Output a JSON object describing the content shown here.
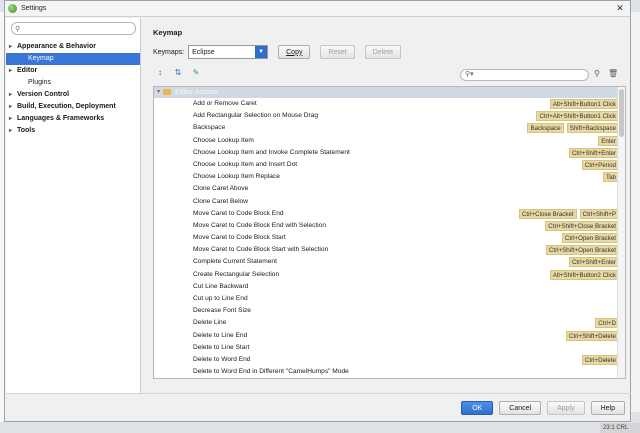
{
  "window": {
    "title": "Settings",
    "close_glyph": "✕"
  },
  "sidebar": {
    "search_placeholder": "",
    "items": [
      {
        "label": "Appearance & Behavior",
        "expander": "▸",
        "bold": true
      },
      {
        "label": "Keymap",
        "selected": true
      },
      {
        "label": "Editor",
        "expander": "▸",
        "bold": true
      },
      {
        "label": "Plugins"
      },
      {
        "label": "Version Control",
        "expander": "▸",
        "bold": true
      },
      {
        "label": "Build, Execution, Deployment",
        "expander": "▸",
        "bold": true
      },
      {
        "label": "Languages & Frameworks",
        "expander": "▸",
        "bold": true
      },
      {
        "label": "Tools",
        "expander": "▸",
        "bold": true
      }
    ]
  },
  "main": {
    "heading": "Keymap",
    "keymaps_label": "Keymaps:",
    "keymap_selected": "Eclipse",
    "copy_label": "Copy",
    "reset_label": "Reset",
    "delete_label": "Delete",
    "filter_placeholder": "",
    "group": {
      "label": "Editor Actions",
      "expander": "▾"
    },
    "actions": [
      {
        "name": "Add or Remove Caret",
        "shortcuts": [
          "Alt+Shift+Button1 Click"
        ]
      },
      {
        "name": "Add Rectangular Selection on Mouse Drag",
        "shortcuts": [
          "Ctrl+Alt+Shift+Button1 Click"
        ]
      },
      {
        "name": "Backspace",
        "shortcuts": [
          "Backspace",
          "Shift+Backspace"
        ]
      },
      {
        "name": "Choose Lookup Item",
        "shortcuts": [
          "Enter"
        ]
      },
      {
        "name": "Choose Lookup Item and Invoke Complete Statement",
        "shortcuts": [
          "Ctrl+Shift+Enter"
        ]
      },
      {
        "name": "Choose Lookup Item and Insert Dot",
        "shortcuts": [
          "Ctrl+Period"
        ]
      },
      {
        "name": "Choose Lookup Item Replace",
        "shortcuts": [
          "Tab"
        ]
      },
      {
        "name": "Clone Caret Above",
        "shortcuts": []
      },
      {
        "name": "Clone Caret Below",
        "shortcuts": []
      },
      {
        "name": "Move Caret to Code Block End",
        "shortcuts": [
          "Ctrl+Close Bracket",
          "Ctrl+Shift+P"
        ]
      },
      {
        "name": "Move Caret to Code Block End with Selection",
        "shortcuts": [
          "Ctrl+Shift+Close Bracket"
        ]
      },
      {
        "name": "Move Caret to Code Block Start",
        "shortcuts": [
          "Ctrl+Open Bracket"
        ]
      },
      {
        "name": "Move Caret to Code Block Start with Selection",
        "shortcuts": [
          "Ctrl+Shift+Open Bracket"
        ]
      },
      {
        "name": "Complete Current Statement",
        "shortcuts": [
          "Ctrl+Shift+Enter"
        ]
      },
      {
        "name": "Create Rectangular Selection",
        "shortcuts": [
          "Alt+Shift+Button2 Click"
        ]
      },
      {
        "name": "Cut Line Backward",
        "shortcuts": []
      },
      {
        "name": "Cut up to Line End",
        "shortcuts": []
      },
      {
        "name": "Decrease Font Size",
        "shortcuts": []
      },
      {
        "name": "Delete Line",
        "shortcuts": [
          "Ctrl+D"
        ]
      },
      {
        "name": "Delete to Line End",
        "shortcuts": [
          "Ctrl+Shift+Delete"
        ]
      },
      {
        "name": "Delete to Line Start",
        "shortcuts": []
      },
      {
        "name": "Delete to Word End",
        "shortcuts": [
          "Ctrl+Delete"
        ]
      },
      {
        "name": "Delete to Word End in Different \"CamelHumps\" Mode",
        "shortcuts": []
      }
    ]
  },
  "footer": {
    "ok": "OK",
    "cancel": "Cancel",
    "apply": "Apply",
    "help": "Help"
  },
  "background": {
    "status_text": "23:1 CRL"
  },
  "colors": {
    "accent": "#3875d7",
    "shortcut_bg": "#e8d8a2",
    "primary_button": "#3a7ad9"
  }
}
